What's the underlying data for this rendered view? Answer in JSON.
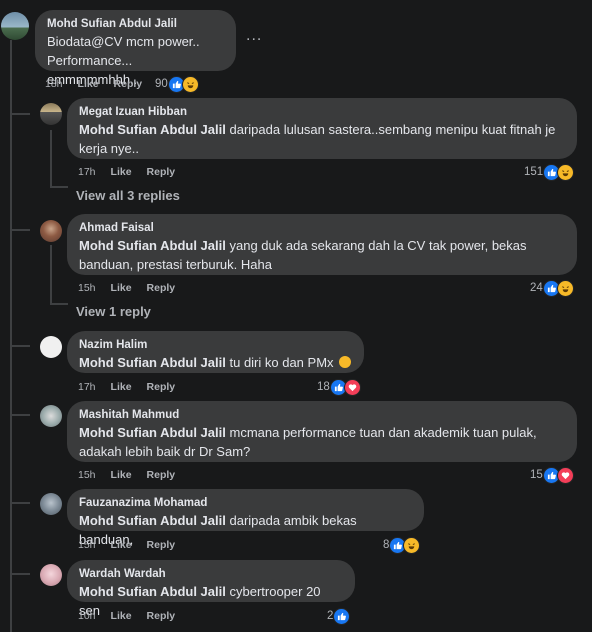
{
  "actions": {
    "like": "Like",
    "reply": "Reply"
  },
  "comments": [
    {
      "author": "Mohd Sufian Abdul Jalil",
      "line1": "Biodata@CV mcm power..",
      "line2": "Performance... emmmmmhhh..",
      "time": "18h",
      "reactions": "90"
    },
    {
      "author": "Megat Izuan Hibban",
      "mention": "Mohd Sufian Abdul Jalil",
      "text": "daripada lulusan sastera..sembang menipu kuat fitnah je kerja nye..",
      "time": "17h",
      "reactions": "151"
    },
    {
      "author": "Ahmad Faisal",
      "mention": "Mohd Sufian Abdul Jalil",
      "text": "yang duk ada sekarang dah la CV tak power, bekas banduan, prestasi terburuk. Haha",
      "time": "15h",
      "reactions": "24"
    },
    {
      "author": "Nazim Halim",
      "mention": "Mohd Sufian Abdul Jalil",
      "text": "tu diri ko dan PMx",
      "time": "17h",
      "reactions": "18"
    },
    {
      "author": "Mashitah Mahmud",
      "mention": "Mohd Sufian Abdul Jalil",
      "text": "mcmana performance tuan dan akademik tuan pulak, adakah lebih baik dr Dr Sam?",
      "time": "15h",
      "reactions": "15"
    },
    {
      "author": "Fauzanazima Mohamad",
      "mention": "Mohd Sufian Abdul Jalil",
      "text": "daripada ambik bekas banduan,",
      "time": "15h",
      "reactions": "8"
    },
    {
      "author": "Wardah Wardah",
      "mention": "Mohd Sufian Abdul Jalil",
      "text": "cybertrooper 20 sen",
      "time": "10h",
      "reactions": "2"
    }
  ],
  "view_replies": [
    "View all 3 replies",
    "View 1 reply"
  ],
  "more_glyph": "...",
  "icons": {
    "like": "thumbs-up-icon",
    "haha": "laughing-face-icon",
    "love": "heart-icon",
    "inline_emoji": "rofl-emoji-icon"
  },
  "colors": {
    "background": "#18191a",
    "bubble": "#3a3b3c",
    "like": "#1877f2",
    "haha": "#f7b928",
    "love": "#f33e58"
  }
}
